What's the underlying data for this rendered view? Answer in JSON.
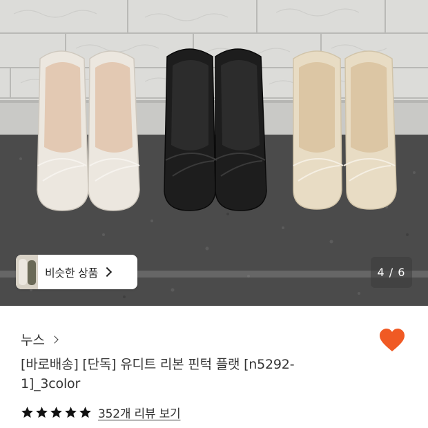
{
  "gallery": {
    "similar_button_label": "비슷한 상품",
    "page_indicator": "4 / 6",
    "current_page": 4,
    "total_pages": 6,
    "shoe_colors": [
      "#ece7df",
      "#1d1d1d",
      "#e8dcc4"
    ]
  },
  "product": {
    "brand": "누스",
    "title_line1": "[바로배송] [단독] 유디트 리본 핀턱 플랫 [n5292-",
    "title_line2": "1]_3color",
    "favorited": true,
    "heart_color": "#f05a24",
    "rating_stars": 5,
    "review_link": "352개 리뷰 보기"
  }
}
